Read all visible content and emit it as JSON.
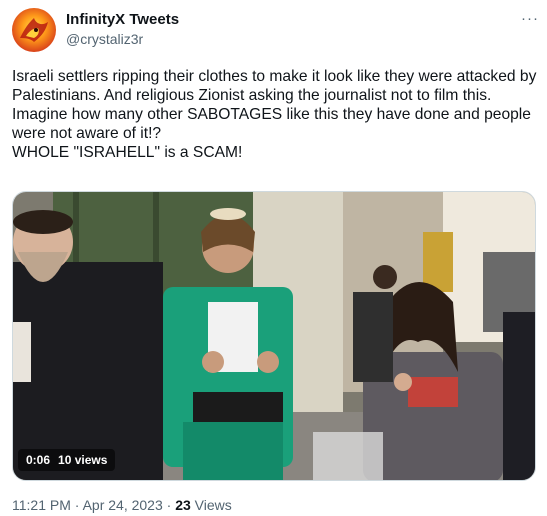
{
  "author": {
    "name": "InfinityX Tweets",
    "handle": "@crystaliz3r",
    "avatar_icon": "phoenix-avatar-icon"
  },
  "more_icon": "more-options-icon",
  "tweet_text": "Israeli settlers ripping their clothes to make it look like they were attacked by Palestinians. And religious Zionist asking the journalist not to film this.\nImagine how many other SABOTAGES like this they have done and people were not aware of it!?\nWHOLE \"ISRAHELL\" is a SCAM!",
  "video": {
    "duration": "0:06",
    "views": "10 views"
  },
  "meta": {
    "time": "11:21 PM",
    "separator": "·",
    "date": "Apr 24, 2023",
    "views_count": "23",
    "views_label": "Views"
  },
  "colors": {
    "text": "#0f1419",
    "secondary": "#536471",
    "border": "#cfd9de"
  }
}
